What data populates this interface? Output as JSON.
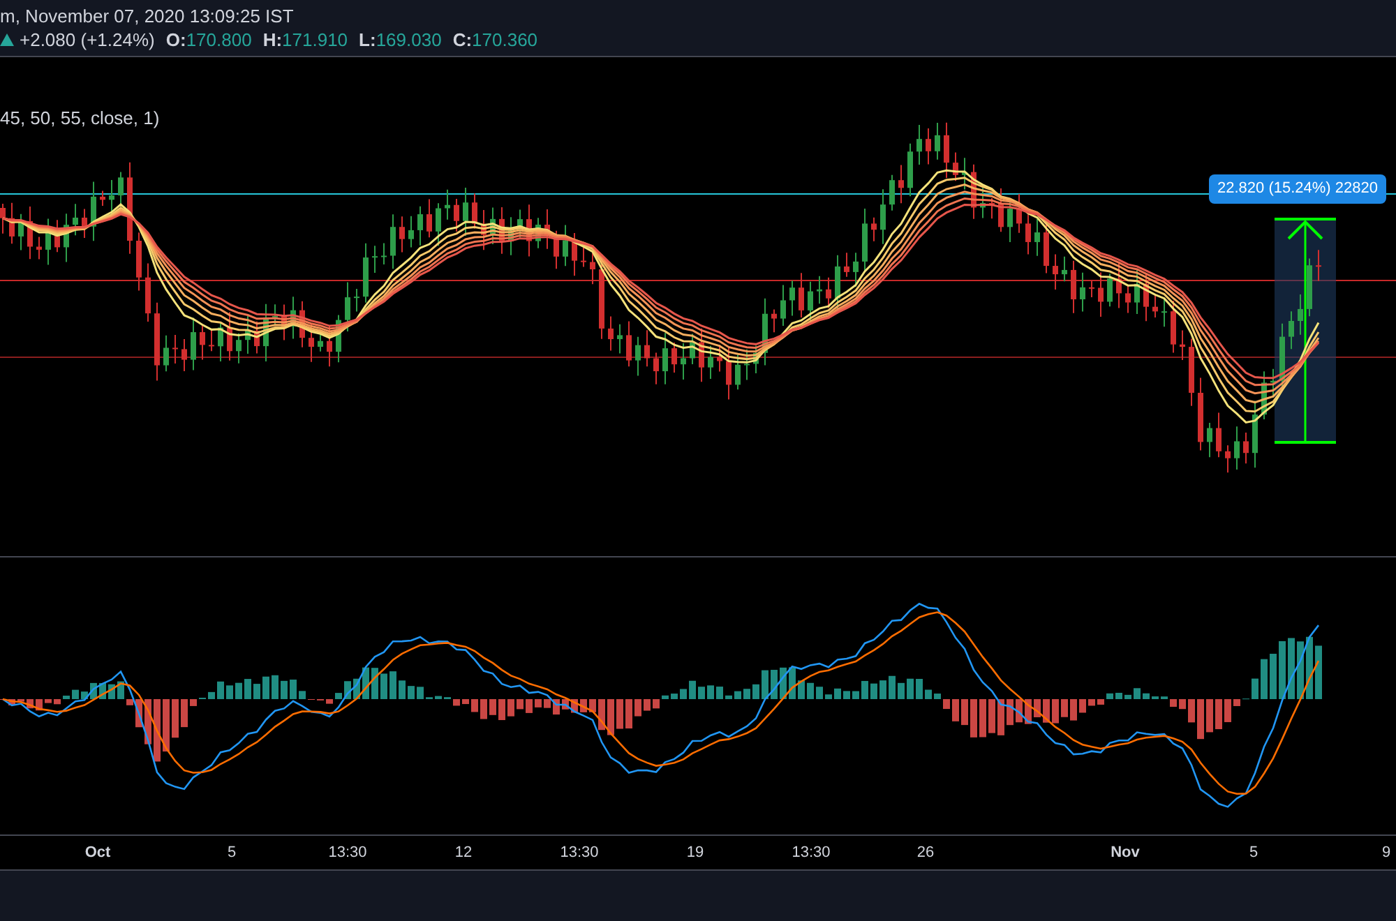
{
  "header": {
    "title": "m, November 07, 2020 13:09:25 IST",
    "change": "+2.080 (+1.24%)",
    "ohlc": [
      {
        "label": "O:",
        "value": "170.800"
      },
      {
        "label": "H:",
        "value": "171.910"
      },
      {
        "label": "L:",
        "value": "169.030"
      },
      {
        "label": "C:",
        "value": "170.360"
      }
    ]
  },
  "indicator_params": "45, 50, 55, close, 1)",
  "measure_label": "22.820 (15.24%) 22820",
  "x_axis": [
    {
      "label": "Oct",
      "kind": "month"
    },
    {
      "label": "5",
      "kind": "day"
    },
    {
      "label": "13:30",
      "kind": "time"
    },
    {
      "label": "12",
      "kind": "day"
    },
    {
      "label": "13:30",
      "kind": "time"
    },
    {
      "label": "19",
      "kind": "day"
    },
    {
      "label": "13:30",
      "kind": "time"
    },
    {
      "label": "26",
      "kind": "day"
    },
    {
      "label": "Nov",
      "kind": "month"
    },
    {
      "label": "5",
      "kind": "day"
    },
    {
      "label": "9",
      "kind": "day"
    }
  ]
}
